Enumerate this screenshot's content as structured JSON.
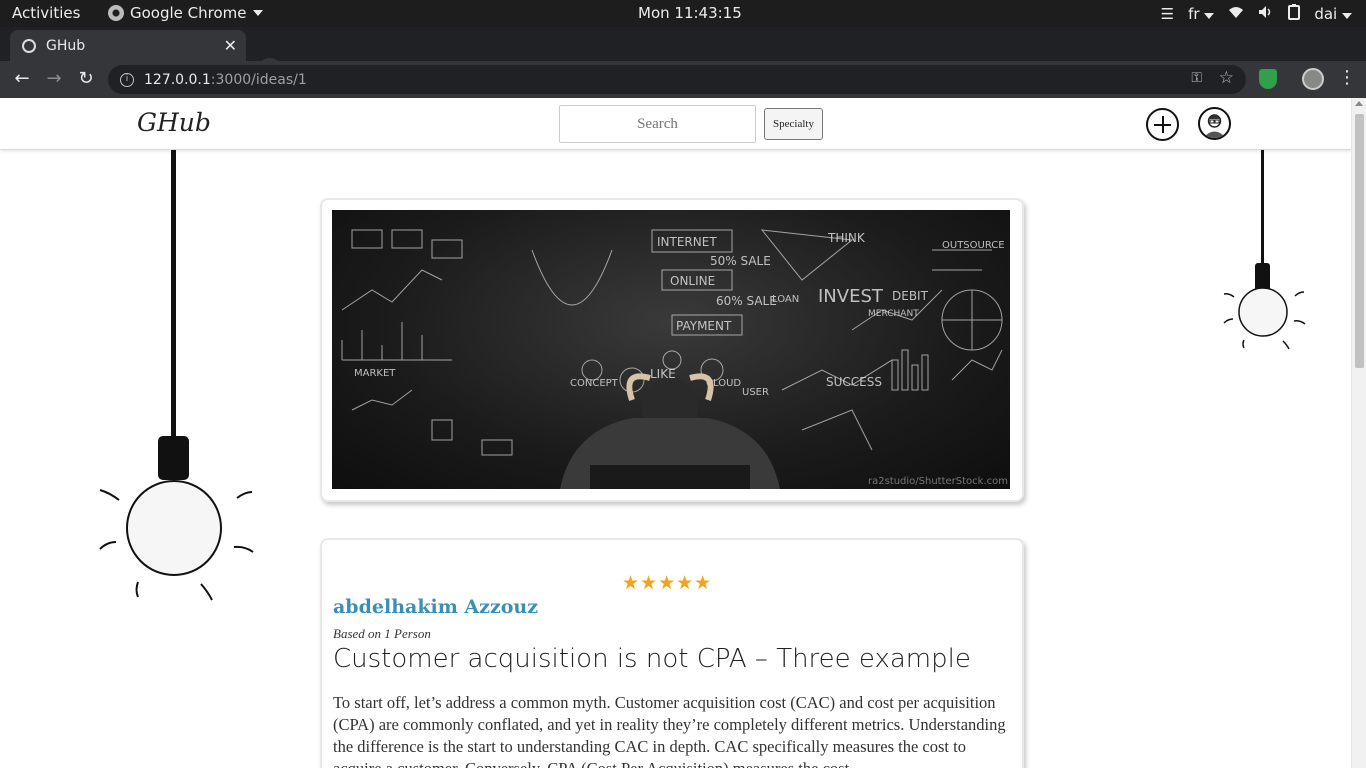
{
  "system_bar": {
    "activities": "Activities",
    "app_name": "Google Chrome",
    "clock": "Mon 11:43:15",
    "keyboard_layout": "fr",
    "user": "dai"
  },
  "browser": {
    "tab_title": "GHub",
    "url_host": "127.0.0.1",
    "url_path": ":3000/ideas/1"
  },
  "site": {
    "logo": "GHub",
    "search_placeholder": "Search",
    "specialty_button": "Specialty"
  },
  "hero": {
    "credit": "ra2studio/ShutterStock.com",
    "chalk_words": [
      "INTERNET",
      "50% SALE",
      "ONLINE",
      "60% SALE",
      "PAYMENT",
      "INVEST",
      "THINK",
      "DEBIT",
      "MERCHANT",
      "SUCCESS",
      "LIKE",
      "CLOUD",
      "USER",
      "CONCEPT",
      "MARKET",
      "OUTSOURCE",
      "LOAN"
    ]
  },
  "idea": {
    "rating": 5,
    "rating_max": 5,
    "stars": "★★★★★",
    "author": "abdelhakim Azzouz",
    "based_on": "Based on 1 Person",
    "title": "Customer acquisition is not CPA – Three example",
    "body": "To start off, let’s address a common myth. Customer acquisition cost (CAC) and cost per acquisition (CPA) are commonly conflated, and yet in reality they’re completely different metrics. Understanding the difference is the start to understanding CAC in depth. CAC specifically measures the cost to acquire a customer. Conversely, CPA (Cost Per Acquisition) measures the cost"
  },
  "colors": {
    "author_link": "#3a8fb7",
    "star": "#f2a31c",
    "shield_extension": "#31a04d"
  }
}
